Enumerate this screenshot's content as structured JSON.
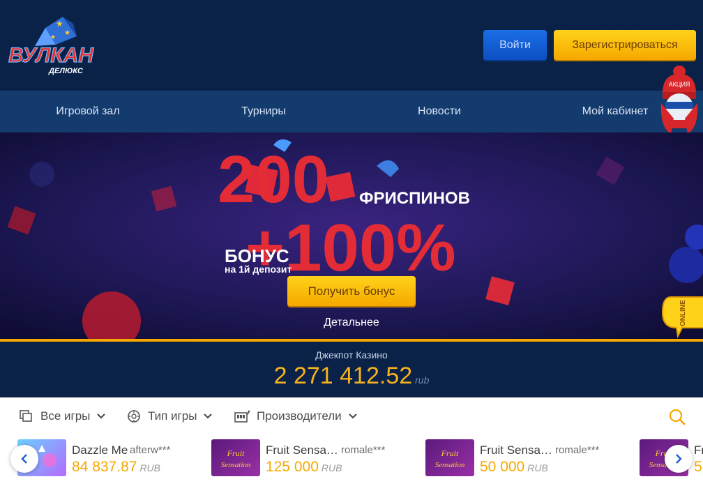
{
  "header": {
    "login_label": "Войти",
    "register_label": "Зарегистрироваться",
    "logo_text": "ВУЛКАН",
    "logo_subtext": "ДЕЛЮКС",
    "mascot_badge": "АКЦИЯ"
  },
  "nav": {
    "items": [
      {
        "label": "Игровой зал"
      },
      {
        "label": "Турниры"
      },
      {
        "label": "Новости"
      },
      {
        "label": "Мой кабинет"
      }
    ]
  },
  "banner": {
    "headline_number": "200",
    "headline_word": "ФРИСПИНОВ",
    "bonus_percent": "+100%",
    "bonus_word": "БОНУС",
    "bonus_sub": "на 1й депозит",
    "cta_label": "Получить бонус",
    "details_label": "Детальнее"
  },
  "online_badge": "ONLINE",
  "jackpot": {
    "label": "Джекпот Казино",
    "value": "2 271 412.52",
    "unit": "rub"
  },
  "filters": {
    "all_games": "Все игры",
    "game_type": "Тип игры",
    "providers": "Производители"
  },
  "winners": [
    {
      "game": "Dazzle Me",
      "user": "afterw***",
      "amount": "84 837.87",
      "currency": "RUB"
    },
    {
      "game": "Fruit Sensa…",
      "user": "romale***",
      "amount": "125 000",
      "currency": "RUB"
    },
    {
      "game": "Fruit Sensa…",
      "user": "romale***",
      "amount": "50 000",
      "currency": "RUB"
    },
    {
      "game": "Fr",
      "user": "",
      "amount": "5",
      "currency": ""
    }
  ],
  "colors": {
    "header_bg": "#0a2148",
    "nav_bg": "#143b6e",
    "accent_yellow": "#f5a800",
    "login_blue": "#1a6ee6"
  }
}
